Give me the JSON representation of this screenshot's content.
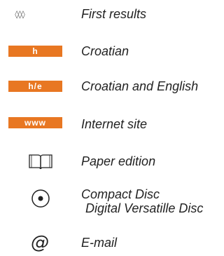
{
  "colors": {
    "badge": "#e87722",
    "text": "#222222"
  },
  "legend": [
    {
      "icon": "diamonds-icon",
      "symbol": "◊◊◊",
      "label": "First results"
    },
    {
      "icon": "croatian-badge-icon",
      "symbol": "h",
      "label": "Croatian"
    },
    {
      "icon": "croatian-english-badge-icon",
      "symbol": "h/e",
      "label": "Croatian and English"
    },
    {
      "icon": "internet-badge-icon",
      "symbol": "www",
      "label": "Internet site"
    },
    {
      "icon": "open-book-icon",
      "symbol": "",
      "label": "Paper edition"
    },
    {
      "icon": "disc-icon",
      "symbol": "",
      "label": "Compact Disc",
      "label2": "Digital Versatille Disc"
    },
    {
      "icon": "at-icon",
      "symbol": "@",
      "label": "E-mail"
    }
  ]
}
